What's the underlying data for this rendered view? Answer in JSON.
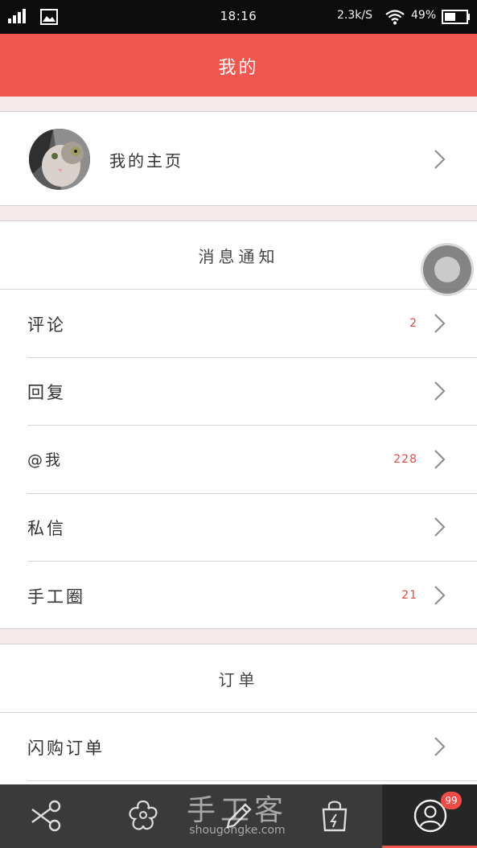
{
  "status_bar": {
    "time": "18:16",
    "net_speed": "2.3k/S",
    "battery": "49%",
    "icons": [
      "signal-icon",
      "image-icon",
      "wifi-icon",
      "battery-icon"
    ]
  },
  "header": {
    "title": "我的"
  },
  "profile": {
    "label": "我的主页"
  },
  "messages": {
    "title": "消息通知",
    "items": [
      {
        "label": "评论",
        "count": "2"
      },
      {
        "label": "回复",
        "count": ""
      },
      {
        "label": "@我",
        "count": "228"
      },
      {
        "label": "私信",
        "count": ""
      },
      {
        "label": "手工圈",
        "count": "21"
      }
    ]
  },
  "orders": {
    "title": "订单",
    "items": [
      {
        "label": "闪购订单"
      }
    ]
  },
  "tab_bar": {
    "tabs": [
      {
        "icon": "scissors-icon",
        "active": false
      },
      {
        "icon": "flower-icon",
        "active": false
      },
      {
        "icon": "pencil-icon",
        "active": false
      },
      {
        "icon": "shopping-bag-icon",
        "active": false
      },
      {
        "icon": "user-icon",
        "active": true,
        "badge": "99"
      }
    ]
  },
  "watermark": {
    "title": "手工客",
    "url": "shougongke.com"
  },
  "colors": {
    "accent": "#ef574f",
    "badge": "#ef4b47",
    "count": "#e04b43",
    "tabbar": "#3a3a3a"
  }
}
